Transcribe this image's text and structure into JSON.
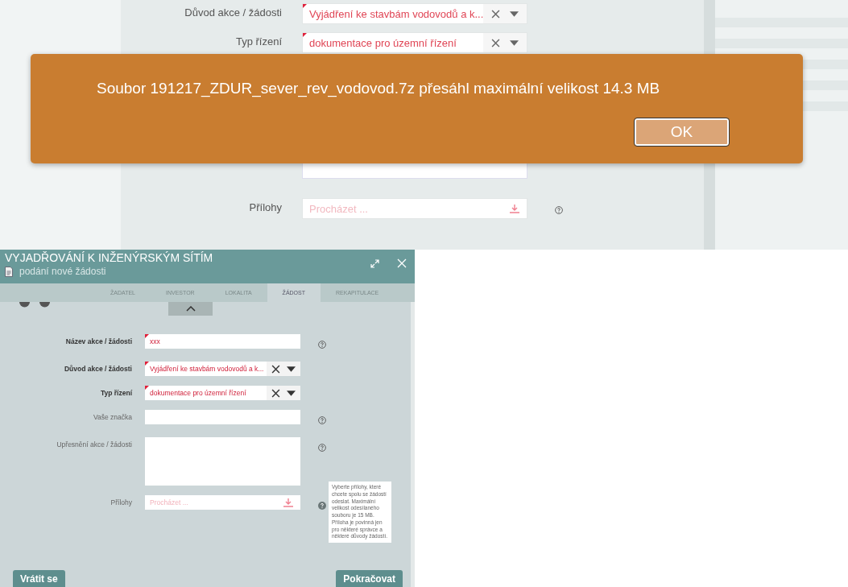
{
  "background_form": {
    "fields": [
      {
        "kind": "select",
        "label": "Důvod akce / žádosti",
        "value": "Vyjádření ke stavbám vodovodů a k...",
        "required": true,
        "help": false
      },
      {
        "kind": "select",
        "label": "Typ řízení",
        "value": "dokumentace pro územní řízení",
        "required": true,
        "help": false
      },
      {
        "kind": "textarea"
      },
      {
        "kind": "file",
        "label": "Přílohy",
        "placeholder": "Procházet ...",
        "required": false,
        "help": true
      }
    ]
  },
  "alert": {
    "message": "Soubor 191217_ZDUR_sever_rev_vodovod.7z přesáhl maximální velikost 14.3 MB",
    "button": "OK"
  },
  "dialog": {
    "title": "VYJADŘOVÁNÍ K INŽENÝRSKÝM SÍTÍM",
    "subtitle": "podání nové žádosti",
    "tabs": [
      {
        "label": "ŽADATEL",
        "selected": false
      },
      {
        "label": "INVESTOR",
        "selected": false
      },
      {
        "label": "LOKALITA",
        "selected": false
      },
      {
        "label": "ŽÁDOST",
        "selected": true
      },
      {
        "label": "REKAPITULACE",
        "selected": false
      }
    ],
    "fields": [
      {
        "kind": "text",
        "label": "Název akce / žádosti",
        "value": "xxx",
        "required": true,
        "help": true
      },
      {
        "kind": "select",
        "label": "Důvod akce / žádosti",
        "value": "Vyjádření ke stavbám vodovodů a k...",
        "required": true,
        "help": false
      },
      {
        "kind": "select",
        "label": "Typ řízení",
        "value": "dokumentace pro územní řízení",
        "required": true,
        "help": false
      },
      {
        "kind": "text",
        "label": "Vaše značka",
        "required": false,
        "help": true
      },
      {
        "kind": "textarea",
        "label": "Upřesnění akce / žádosti",
        "required": false,
        "help": true
      },
      {
        "kind": "file",
        "label": "Přílohy",
        "placeholder": "Procházet ...",
        "required": false,
        "help": true
      }
    ],
    "tooltip": "Vyberte přílohy, které chcete spolu se žádostí odeslat. Maximální velikost odesílaného souboru je 15 MB. Příloha je povinná jen pro některé správce a některé důvody žádostí.",
    "back_button": "Vrátit se",
    "next_button": "Pokračovat"
  }
}
